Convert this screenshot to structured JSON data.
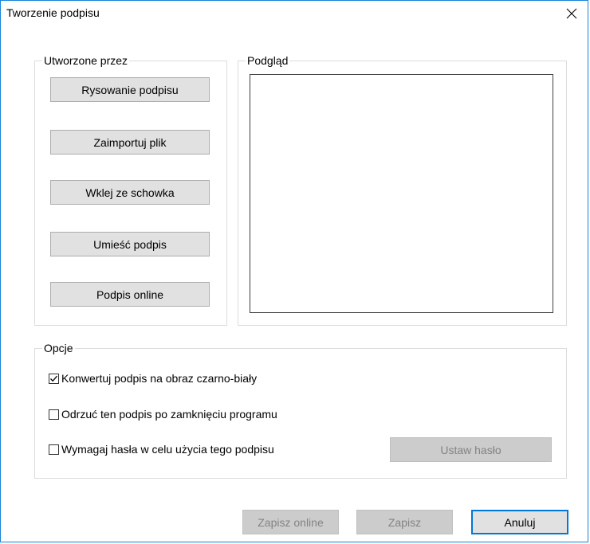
{
  "window": {
    "title": "Tworzenie podpisu"
  },
  "created_by": {
    "legend": "Utworzone przez",
    "buttons": [
      {
        "label": "Rysowanie podpisu"
      },
      {
        "label": "Zaimportuj plik"
      },
      {
        "label": "Wklej ze schowka"
      },
      {
        "label": "Umieść podpis"
      },
      {
        "label": "Podpis online"
      }
    ]
  },
  "preview": {
    "legend": "Podgląd"
  },
  "options": {
    "legend": "Opcje",
    "checkboxes": [
      {
        "label": "Konwertuj podpis na obraz czarno-biały",
        "checked": true
      },
      {
        "label": "Odrzuć ten podpis po zamknięciu programu",
        "checked": false
      },
      {
        "label": "Wymagaj hasła w celu użycia tego podpisu",
        "checked": false
      }
    ],
    "set_password_label": "Ustaw hasło"
  },
  "footer": {
    "save_online_label": "Zapisz online",
    "save_label": "Zapisz",
    "cancel_label": "Anuluj"
  },
  "colors": {
    "window_border": "#1883d7",
    "button_bg": "#e1e1e1",
    "button_disabled_bg": "#cccccc",
    "default_button_border": "#0078d7"
  },
  "icons": {
    "close": "close-icon",
    "checkmark": "checkmark-icon"
  }
}
